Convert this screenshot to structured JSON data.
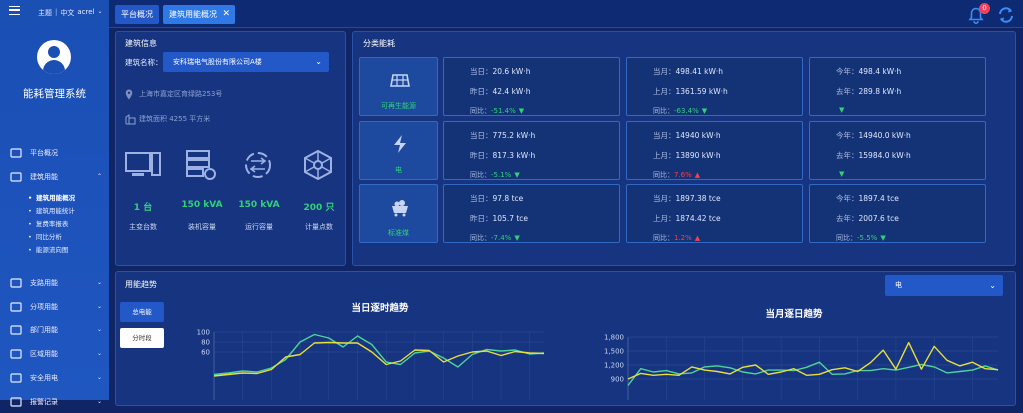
{
  "app": {
    "title": "能耗管理系统",
    "top_links": [
      "主题",
      "中文",
      "acrel"
    ],
    "notif_count": "0"
  },
  "tabs": [
    {
      "label": "平台概况"
    },
    {
      "label": "建筑用能概况"
    }
  ],
  "menu": [
    {
      "label": "平台概况",
      "icon": "monitor-icon"
    },
    {
      "label": "建筑用能",
      "icon": "building-icon",
      "open": true
    },
    {
      "label": "支路用能",
      "icon": "branch-icon"
    },
    {
      "label": "分项用能",
      "icon": "circle-icon"
    },
    {
      "label": "部门用能",
      "icon": "folder-icon"
    },
    {
      "label": "区域用能",
      "icon": "region-icon"
    },
    {
      "label": "安全用电",
      "icon": "shield-icon"
    },
    {
      "label": "报警记录",
      "icon": "alarm-icon"
    }
  ],
  "submenu": [
    "建筑用能概况",
    "建筑用能统计",
    "复费率报表",
    "同比分析",
    "能源流向图"
  ],
  "building": {
    "title": "建筑信息",
    "name_label": "建筑名称：",
    "name_value": "安科瑞电气股份有限公司A楼",
    "address": "上海市嘉定区育绿路253号",
    "area": "建筑面积 4255 平方米",
    "stats": [
      {
        "value": "1 台",
        "label": "主变台数"
      },
      {
        "value": "150 kVA",
        "label": "装机容量"
      },
      {
        "value": "150 kVA",
        "label": "运行容量"
      },
      {
        "value": "200 只",
        "label": "计量点数"
      }
    ]
  },
  "energy": {
    "title": "分类能耗",
    "rows": [
      {
        "name": "可再生能源",
        "icon": "solar-icon",
        "day": {
          "k1": "当日：",
          "v1": "20.6 kW·h",
          "k2": "昨日：",
          "v2": "42.4 kW·h",
          "pk": "同比：",
          "pv": "-51.4%",
          "dir": "down"
        },
        "month": {
          "k1": "当月：",
          "v1": "498.41 kW·h",
          "k2": "上月：",
          "v2": "1361.59 kW·h",
          "pk": "同比：",
          "pv": "-63.4%",
          "dir": "down"
        },
        "year": {
          "k1": "今年：",
          "v1": "498.4 kW·h",
          "k2": "去年：",
          "v2": "289.8 kW·h",
          "pk": "",
          "pv": "",
          "dir": "down"
        }
      },
      {
        "name": "电",
        "icon": "lightning-icon",
        "day": {
          "k1": "当日：",
          "v1": "775.2 kW·h",
          "k2": "昨日：",
          "v2": "817.3 kW·h",
          "pk": "同比：",
          "pv": "-5.1%",
          "dir": "down"
        },
        "month": {
          "k1": "当月：",
          "v1": "14940 kW·h",
          "k2": "上月：",
          "v2": "13890 kW·h",
          "pk": "同比：",
          "pv": "7.6%",
          "dir": "up"
        },
        "year": {
          "k1": "今年：",
          "v1": "14940.0 kW·h",
          "k2": "去年：",
          "v2": "15984.0 kW·h",
          "pk": "",
          "pv": "",
          "dir": "down"
        }
      },
      {
        "name": "标准煤",
        "icon": "coal-icon",
        "day": {
          "k1": "当日：",
          "v1": "97.8 tce",
          "k2": "昨日：",
          "v2": "105.7 tce",
          "pk": "同比：",
          "pv": "-7.4%",
          "dir": "down"
        },
        "month": {
          "k1": "当月：",
          "v1": "1897.38 tce",
          "k2": "上月：",
          "v2": "1874.42 tce",
          "pk": "同比：",
          "pv": "1.2%",
          "dir": "up"
        },
        "year": {
          "k1": "今年：",
          "v1": "1897.4 tce",
          "k2": "去年：",
          "v2": "2007.6 tce",
          "pk": "同比：",
          "pv": "-5.5%",
          "dir": "down"
        }
      }
    ]
  },
  "trend": {
    "title": "用能趋势",
    "select": "电",
    "btn_total": "总电能",
    "btn_time": "分时段"
  },
  "chart_data": [
    {
      "type": "line",
      "title": "当日逐时趋势",
      "ylim": [
        0,
        100
      ],
      "yticks": [
        "100",
        "80",
        "60"
      ],
      "series": [
        {
          "color": "#4fd39a",
          "values": [
            15,
            18,
            22,
            20,
            28,
            45,
            80,
            95,
            88,
            70,
            92,
            75,
            40,
            35,
            58,
            62,
            48,
            30,
            55,
            65,
            62,
            64,
            56,
            58
          ]
        },
        {
          "color": "#e7df3a",
          "values": [
            12,
            15,
            18,
            17,
            25,
            50,
            55,
            78,
            79,
            78,
            78,
            60,
            35,
            42,
            64,
            63,
            40,
            52,
            60,
            62,
            53,
            61,
            58,
            57
          ]
        }
      ]
    },
    {
      "type": "line",
      "title": "当月逐日趋势",
      "ylim": [
        600,
        1800
      ],
      "yticks": [
        "1,800",
        "1,500",
        "1,200",
        "900"
      ],
      "series": [
        {
          "color": "#4fd39a",
          "values": [
            760,
            1120,
            1050,
            1080,
            1010,
            1030,
            1160,
            1180,
            1140,
            1050,
            1010,
            1090,
            1090,
            1080,
            1150,
            1260,
            1000,
            1010,
            1080,
            1080,
            1120,
            1090,
            1150,
            1210,
            1160,
            1030,
            1060,
            1090,
            1180,
            1090
          ]
        },
        {
          "color": "#e7df3a",
          "values": [
            900,
            1020,
            980,
            1000,
            980,
            1160,
            1090,
            1060,
            1010,
            1150,
            1200,
            1000,
            1050,
            1120,
            980,
            1000,
            1100,
            1140,
            1060,
            1250,
            1520,
            1110,
            1680,
            1110,
            1600,
            1300,
            1180,
            1260,
            1120,
            1100
          ]
        }
      ]
    }
  ]
}
